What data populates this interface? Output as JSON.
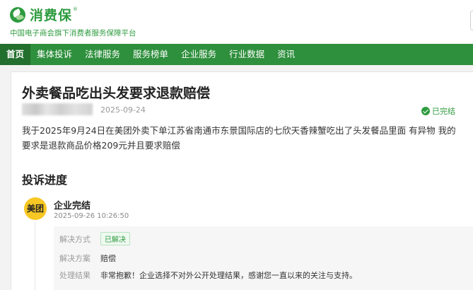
{
  "brand": {
    "name": "消费保",
    "reg_mark": "®",
    "tagline": "中国电子商会旗下消费者服务保障平台"
  },
  "nav": {
    "items": [
      {
        "label": "首页"
      },
      {
        "label": "集体投诉"
      },
      {
        "label": "法律服务"
      },
      {
        "label": "服务榜单"
      },
      {
        "label": "企业服务"
      },
      {
        "label": "行业数据"
      },
      {
        "label": "资讯"
      }
    ]
  },
  "complaint": {
    "title": "外卖餐品吃出头发要求退款赔偿",
    "date": "2025-09-24",
    "status": "已完结",
    "description": "我于2025年9月24日在美团外卖下单江苏省南通市东景国际店的七欣天香辣蟹吃出了头发餐品里面 有异物 我的要求是退款商品价格209元并且要求赔偿"
  },
  "progress": {
    "section_title": "投诉进度",
    "company_logo_text": "美团",
    "step_title": "企业完结",
    "step_time": "2025-09-26 10:26:50",
    "rows": [
      {
        "label": "解决方式",
        "value": "已解决",
        "is_tag": true
      },
      {
        "label": "解决方案",
        "value": "赔偿"
      },
      {
        "label": "处理结果",
        "value": "非常抱歉！企业选择不对外公开处理结果，感谢您一直以来的关注与支持。"
      }
    ]
  },
  "colors": {
    "brand_green": "#2e9b3f",
    "nav_green": "#2e8f3c",
    "nav_active": "#236f2e",
    "meituan_yellow": "#f7c824"
  }
}
